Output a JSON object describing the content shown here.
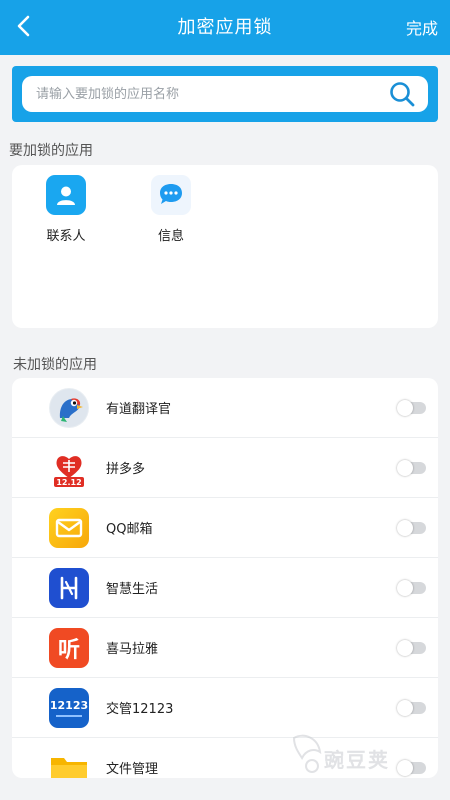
{
  "header": {
    "title": "加密应用锁",
    "done_label": "完成",
    "background": "#17a2e8"
  },
  "search": {
    "placeholder": "请输入要加锁的应用名称",
    "value": ""
  },
  "locked_section": {
    "label": "要加锁的应用",
    "apps": [
      {
        "name": "联系人",
        "icon": "contacts-icon",
        "color": "#1aa7f0"
      },
      {
        "name": "信息",
        "icon": "messages-icon",
        "color": "#1e9bf0"
      }
    ]
  },
  "unlocked_section": {
    "label": "未加锁的应用",
    "apps": [
      {
        "name": "有道翻译官",
        "icon": "youdao-translate-icon",
        "locked": false
      },
      {
        "name": "拼多多",
        "icon": "pinduoduo-icon",
        "badge": "12.12",
        "locked": false
      },
      {
        "name": "QQ邮箱",
        "icon": "qq-mail-icon",
        "locked": false
      },
      {
        "name": "智慧生活",
        "icon": "smart-life-icon",
        "locked": false
      },
      {
        "name": "喜马拉雅",
        "icon": "ximalaya-icon",
        "icon_text": "听",
        "locked": false
      },
      {
        "name": "交管12123",
        "icon": "traffic-12123-icon",
        "icon_text": "12123",
        "locked": false
      },
      {
        "name": "文件管理",
        "icon": "file-manager-icon",
        "locked": false
      }
    ]
  },
  "watermark": {
    "text": "豌豆荚"
  }
}
